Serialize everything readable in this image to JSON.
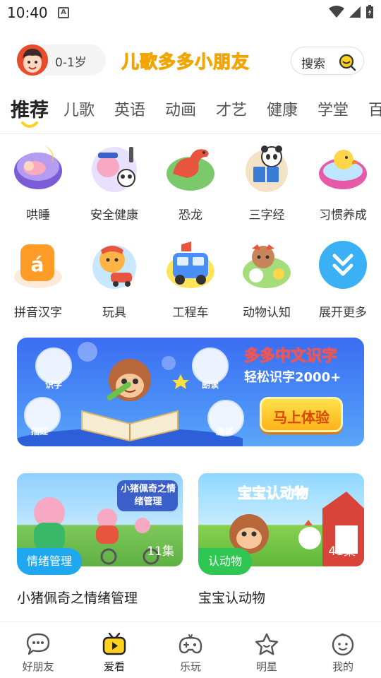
{
  "status_bar": {
    "time": "10:40",
    "notification_glyph": "A"
  },
  "header": {
    "age_label": "0-1岁",
    "brand_title": "儿歌多多小朋友",
    "search_label": "搜索"
  },
  "tabs": [
    {
      "label": "推荐",
      "active": true
    },
    {
      "label": "儿歌"
    },
    {
      "label": "英语"
    },
    {
      "label": "动画"
    },
    {
      "label": "才艺"
    },
    {
      "label": "健康"
    },
    {
      "label": "学堂"
    },
    {
      "label": "百"
    }
  ],
  "categories": [
    {
      "label": "哄睡",
      "icon": "sleeping-baby-moon-icon"
    },
    {
      "label": "安全健康",
      "icon": "pig-and-panda-police-icon"
    },
    {
      "label": "恐龙",
      "icon": "dinosaur-icon"
    },
    {
      "label": "三字经",
      "icon": "panda-reading-icon"
    },
    {
      "label": "习惯养成",
      "icon": "duck-bathtub-icon"
    },
    {
      "label": "拼音汉字",
      "icon": "pinyin-a-icon"
    },
    {
      "label": "玩具",
      "icon": "tiger-toy-car-icon"
    },
    {
      "label": "工程车",
      "icon": "truck-icon"
    },
    {
      "label": "动物认知",
      "icon": "animals-icon"
    },
    {
      "label": "展开更多",
      "icon": "expand-more-icon"
    }
  ],
  "banner": {
    "title": "多多中文识字",
    "subtitle": "轻松识字2000+",
    "cta": "马上体验",
    "bubbles": [
      "识字",
      "朗读",
      "描红",
      "测试"
    ]
  },
  "cards": [
    {
      "thumb_caption": "小猪佩奇之情绪管理",
      "tag": "情绪管理",
      "count": "11集",
      "title": "小猪佩奇之情绪管理"
    },
    {
      "thumb_caption": "宝宝认动物",
      "tag": "认动物",
      "count": "41集",
      "title": "宝宝认动物"
    }
  ],
  "bottom_nav": [
    {
      "label": "好朋友",
      "icon": "chat-bubble-icon"
    },
    {
      "label": "爱看",
      "icon": "tv-icon",
      "active": true
    },
    {
      "label": "乐玩",
      "icon": "gamepad-icon"
    },
    {
      "label": "明星",
      "icon": "star-icon"
    },
    {
      "label": "我的",
      "icon": "baby-face-icon"
    }
  ],
  "colors": {
    "accent_yellow": "#ffd21f",
    "tag_blue": "#1fa8f0",
    "tag_green": "#2fc752",
    "expand_blue": "#3bb0f5"
  }
}
